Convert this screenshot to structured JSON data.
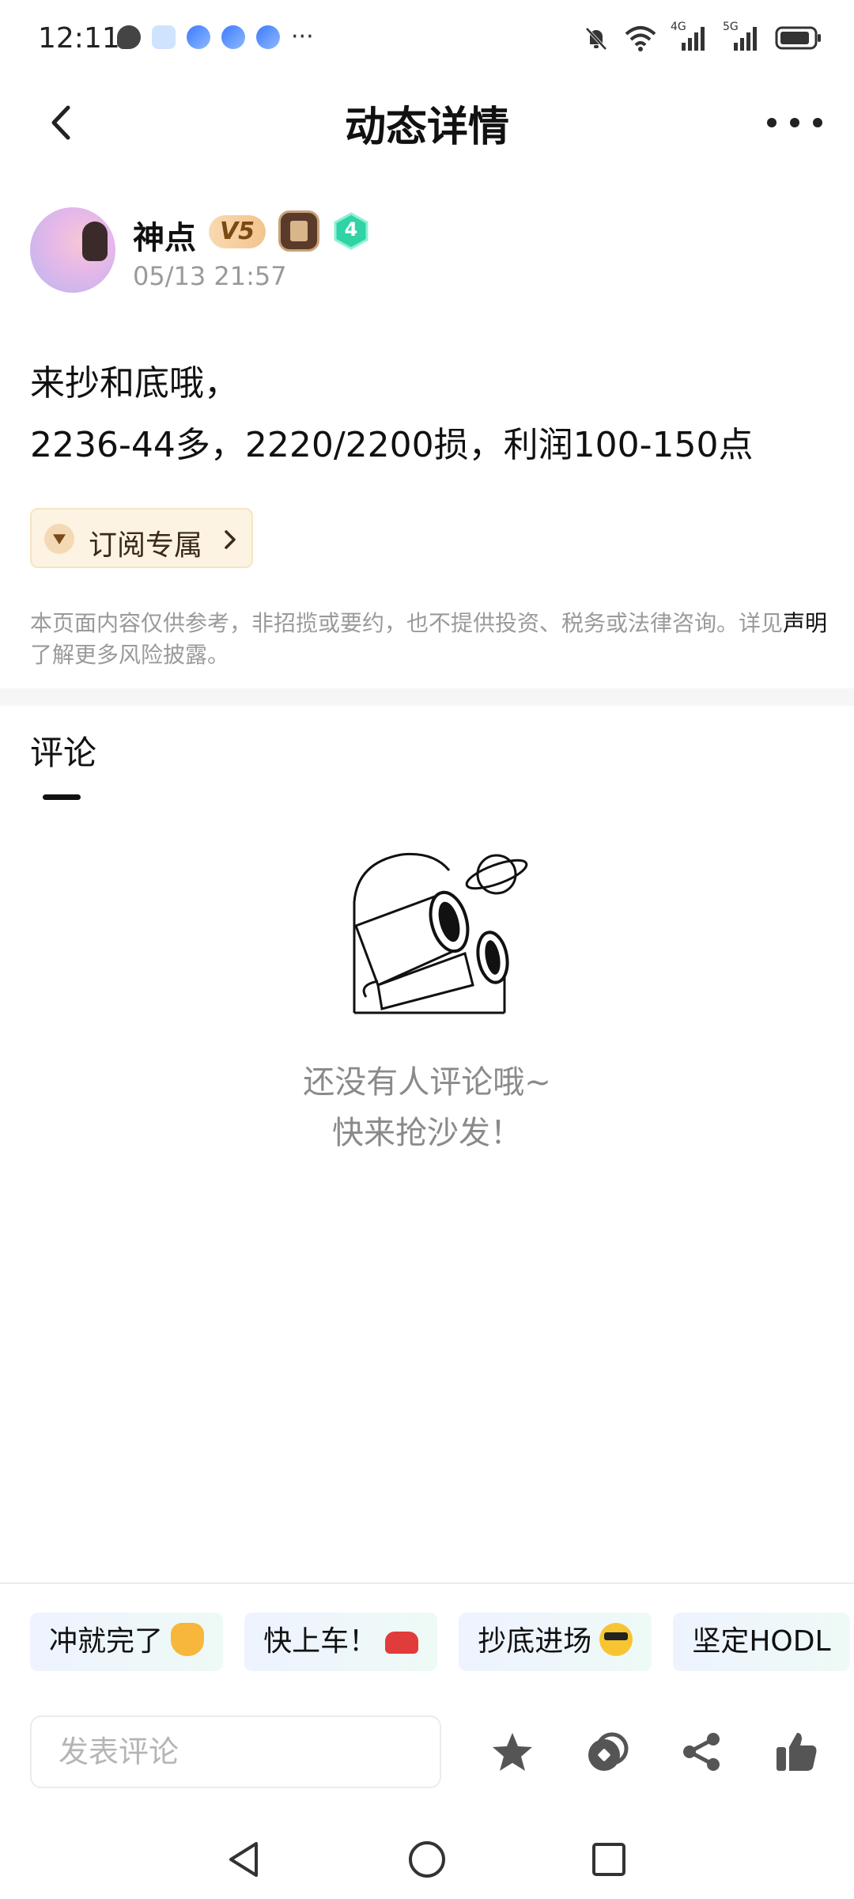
{
  "status_bar": {
    "time": "12:11",
    "network1": "4G",
    "network2": "5G"
  },
  "header": {
    "title": "动态详情"
  },
  "author": {
    "name": "神点",
    "vip_label": "V5",
    "fans_level": "4",
    "post_time": "05/13 21:57"
  },
  "post": {
    "line1": "来抄和底哦，",
    "line2": "2236-44多，2220/2200损，利润100-150点"
  },
  "subscribe": {
    "label": "订阅专属"
  },
  "disclaimer": {
    "text_before": "本页面内容仅供参考，非招揽或要约，也不提供投资、税务或法律咨询。详见",
    "link": "声明",
    "text_after": "了解更多风险披露。"
  },
  "comments": {
    "title": "评论",
    "empty_line1": "还没有人评论哦~",
    "empty_line2": "快来抢沙发！"
  },
  "quick_replies": [
    {
      "label": "冲就完了",
      "emoji": "fist-emoji"
    },
    {
      "label": "快上车！",
      "emoji": "car-emoji"
    },
    {
      "label": "抄底进场",
      "emoji": "cool-face-emoji"
    },
    {
      "label": "坚定HODL",
      "emoji": ""
    }
  ],
  "comment_input": {
    "placeholder": "发表评论"
  },
  "actions": [
    "star-icon",
    "coin-icon",
    "share-icon",
    "like-icon"
  ],
  "colors": {
    "vip_gold": "#f3c48e",
    "fans_green": "#2fd3a6",
    "subscribe_bg": "#fdf3e2",
    "muted_text": "#9a9a9a"
  }
}
